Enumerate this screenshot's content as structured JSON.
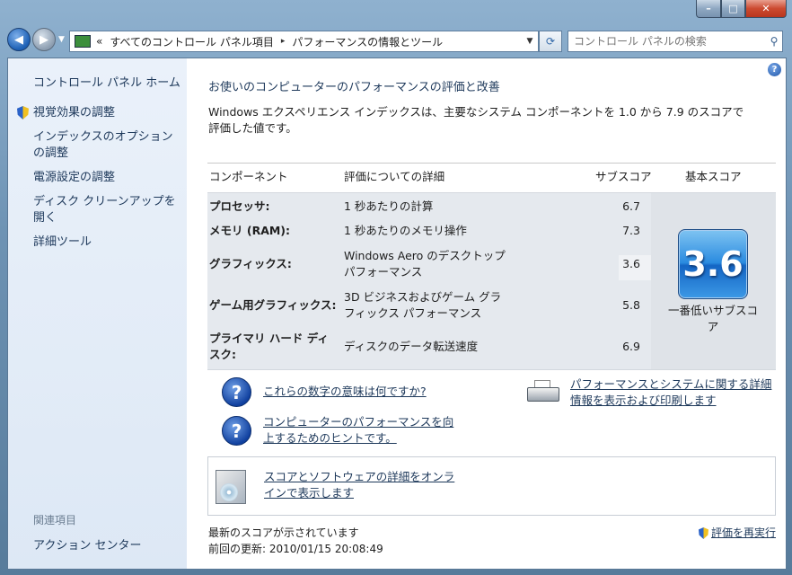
{
  "window": {
    "min_label": "–",
    "max_label": "□",
    "close_label": "✕"
  },
  "nav": {
    "back_icon": "back-arrow-icon",
    "forward_icon": "forward-arrow-icon"
  },
  "address": {
    "prefix": "«",
    "crumb1": "すべてのコントロール パネル項目",
    "separator": "▸",
    "crumb2": "パフォーマンスの情報とツール"
  },
  "search": {
    "placeholder": "コントロール パネルの検索"
  },
  "sidebar": {
    "home": "コントロール パネル ホーム",
    "items": [
      {
        "label": "視覚効果の調整",
        "shield": true
      },
      {
        "label": "インデックスのオプションの調整",
        "shield": false
      },
      {
        "label": "電源設定の調整",
        "shield": false
      },
      {
        "label": "ディスク クリーンアップを開く",
        "shield": false
      },
      {
        "label": "詳細ツール",
        "shield": false
      }
    ],
    "related_header": "関連項目",
    "action_center": "アクション センター"
  },
  "main": {
    "title": "お使いのコンピューターのパフォーマンスの評価と改善",
    "description": "Windows エクスペリエンス インデックスは、主要なシステム コンポーネントを 1.0 から 7.9 のスコアで評価した値です。",
    "table": {
      "headers": {
        "component": "コンポーネント",
        "detail": "評価についての詳細",
        "subscore": "サブスコア",
        "base": "基本スコア"
      },
      "rows": [
        {
          "component": "プロセッサ:",
          "detail": "1 秒あたりの計算",
          "subscore": "6.7"
        },
        {
          "component": "メモリ (RAM):",
          "detail": "1 秒あたりのメモリ操作",
          "subscore": "7.3"
        },
        {
          "component": "グラフィックス:",
          "detail": "Windows Aero のデスクトップ パフォーマンス",
          "subscore": "3.6"
        },
        {
          "component": "ゲーム用グラフィックス:",
          "detail": "3D ビジネスおよびゲーム グラフィックス パフォーマンス",
          "subscore": "5.8"
        },
        {
          "component": "プライマリ ハード ディスク:",
          "detail": "ディスクのデータ転送速度",
          "subscore": "6.9"
        }
      ],
      "base_score": "3.6",
      "base_label": "一番低いサブスコア"
    },
    "links": {
      "what_mean": "これらの数字の意味は何ですか?",
      "tips": "コンピューターのパフォーマンスを向上するためのヒントです。",
      "print": "パフォーマンスとシステムに関する詳細情報を表示および印刷します",
      "online": "スコアとソフトウェアの詳細をオンラインで表示します"
    },
    "status": {
      "latest": "最新のスコアが示されています",
      "last_update": "前回の更新: 2010/01/15 20:08:49",
      "rerun": "評価を再実行"
    }
  },
  "colors": {
    "link": "#1e395b",
    "sidebar_bg": "#e3ecf7",
    "table_bg": "#e5e9ee",
    "badge": "#2a8be0"
  }
}
